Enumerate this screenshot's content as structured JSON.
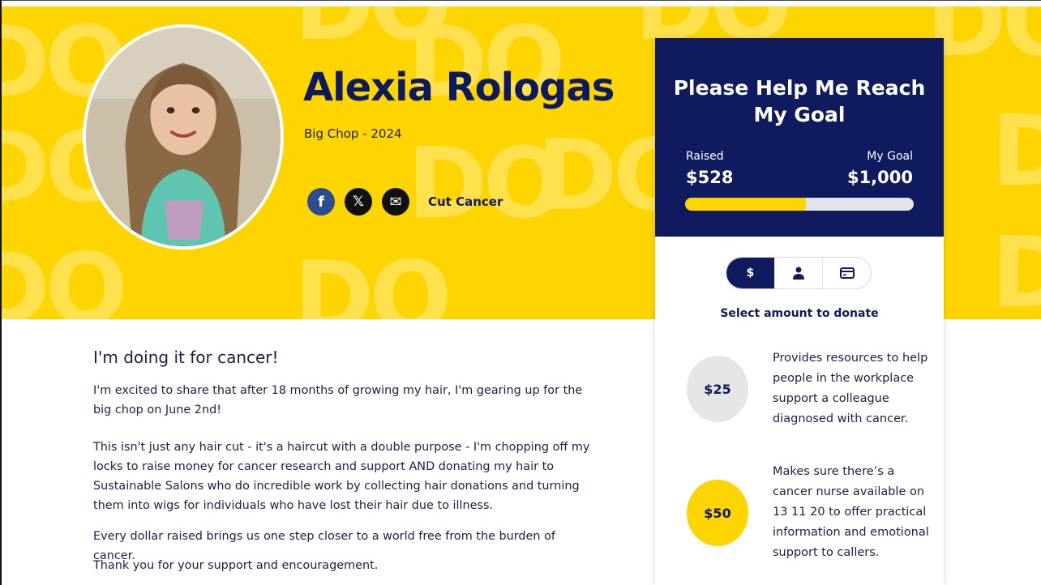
{
  "profile": {
    "name": "Alexia Rologas",
    "event": "Big Chop - 2024",
    "team_link": "Cut Cancer"
  },
  "social": {
    "facebook_label": "f",
    "x_label": "𝕏",
    "email_label": "✉"
  },
  "donation_panel": {
    "title": "Please Help Me Reach My Goal",
    "raised_label": "Raised",
    "raised_value": "$528",
    "goal_label": "My Goal",
    "goal_value": "$1,000",
    "progress_fraction": 0.528,
    "tabs": [
      "$",
      "person",
      "card"
    ],
    "select_label": "Select amount to donate",
    "amounts": [
      {
        "value": "$25",
        "description": "Provides resources to help people in the workplace support a colleague diagnosed with cancer."
      },
      {
        "value": "$50",
        "description": "Makes sure there’s a cancer nurse available on 13 11 20 to offer practical information and emotional support to callers."
      }
    ]
  },
  "story": {
    "title": "I'm doing it for cancer!",
    "paragraphs": [
      "I'm excited to share that after 18 months of growing my hair, I'm gearing up for the big chop on June 2nd!",
      "This isn't just any hair cut - it's a haircut with a double purpose - I'm chopping off my locks to raise money for cancer research and support AND donating my hair to Sustainable Salons who do incredible work by collecting hair donations and turning them into wigs for individuals who have lost their hair due to illness.",
      "Every dollar raised brings us one step closer to a world free from the burden of cancer.",
      "Thank you for your support and encouragement."
    ]
  },
  "colors": {
    "brand_yellow": "#ffd500",
    "brand_navy": "#0f1b5e",
    "facebook_blue": "#2c4d92"
  }
}
